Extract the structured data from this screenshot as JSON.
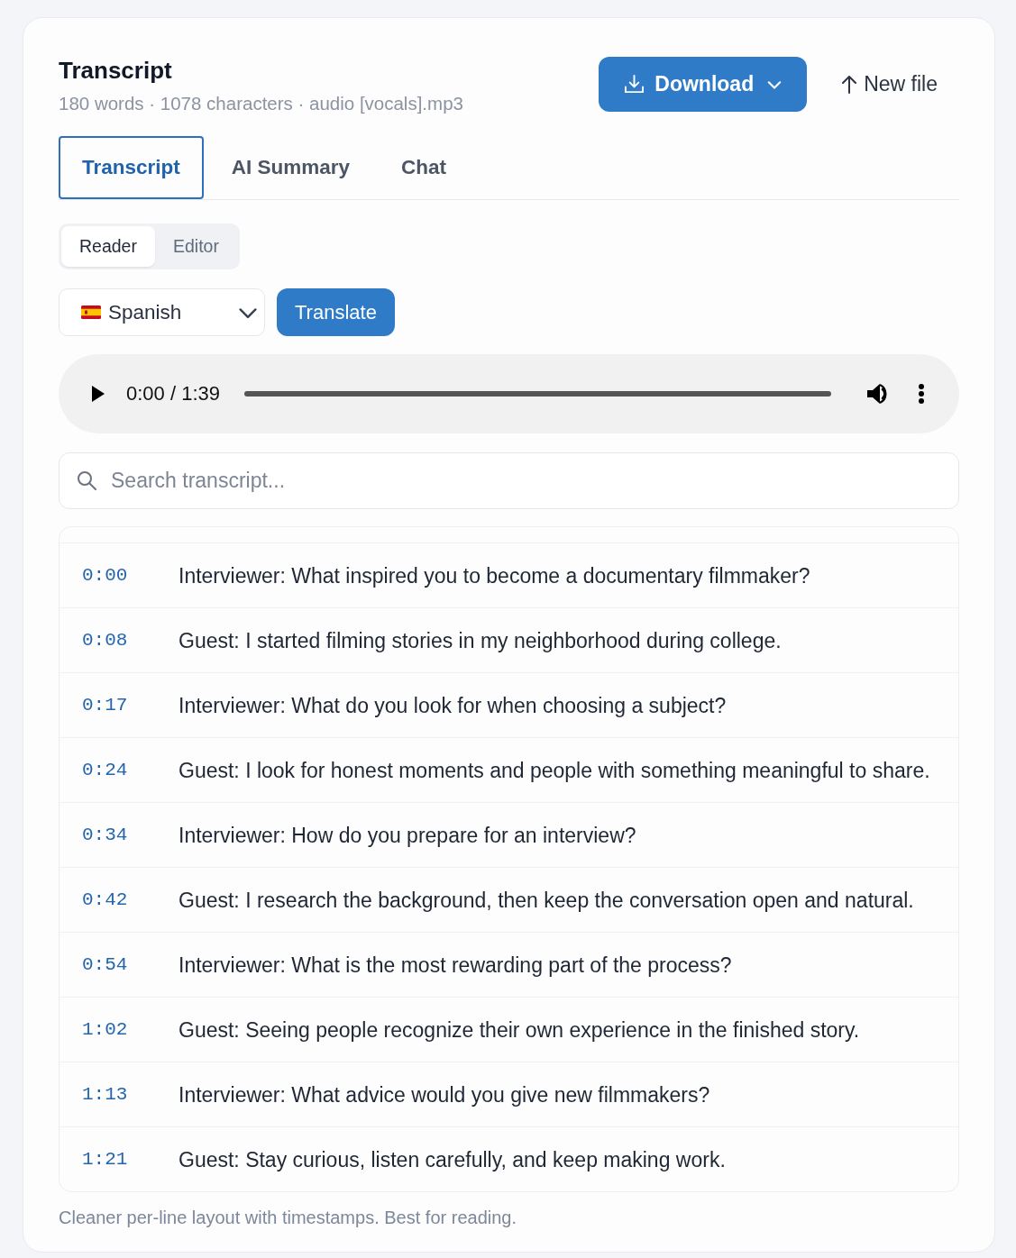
{
  "header": {
    "title": "Transcript",
    "meta": "180 words · 1078 characters · audio [vocals].mp3"
  },
  "actions": [
    {
      "kind": "download",
      "label": "Download",
      "has_menu": true
    },
    {
      "kind": "upload",
      "label": "New file",
      "has_menu": false
    }
  ],
  "tabs": [
    {
      "label": "Transcript",
      "selected": true
    },
    {
      "label": "AI Summary",
      "selected": false
    },
    {
      "label": "Chat",
      "selected": false
    }
  ],
  "view_modes": [
    {
      "label": "Reader",
      "selected": true
    },
    {
      "label": "Editor",
      "selected": false
    }
  ],
  "translation": {
    "language": "Spanish",
    "button": "Translate"
  },
  "player": {
    "time": "0:00 / 1:39"
  },
  "search": {
    "placeholder": "Search transcript..."
  },
  "lines": [
    {
      "time": "0:00",
      "text": "Interviewer: What inspired you to become a documentary filmmaker?"
    },
    {
      "time": "0:08",
      "text": "Guest: I started filming stories in my neighborhood during college."
    },
    {
      "time": "0:17",
      "text": "Interviewer: What do you look for when choosing a subject?"
    },
    {
      "time": "0:24",
      "text": "Guest: I look for honest moments and people with something meaningful to share."
    },
    {
      "time": "0:34",
      "text": "Interviewer: How do you prepare for an interview?"
    },
    {
      "time": "0:42",
      "text": "Guest: I research the background, then keep the conversation open and natural."
    },
    {
      "time": "0:54",
      "text": "Interviewer: What is the most rewarding part of the process?"
    },
    {
      "time": "1:02",
      "text": "Guest: Seeing people recognize their own experience in the finished story."
    },
    {
      "time": "1:13",
      "text": "Interviewer: What advice would you give new filmmakers?"
    },
    {
      "time": "1:21",
      "text": "Guest: Stay curious, listen carefully, and keep making work."
    }
  ],
  "note": "Cleaner per-line layout with timestamps. Best for reading."
}
